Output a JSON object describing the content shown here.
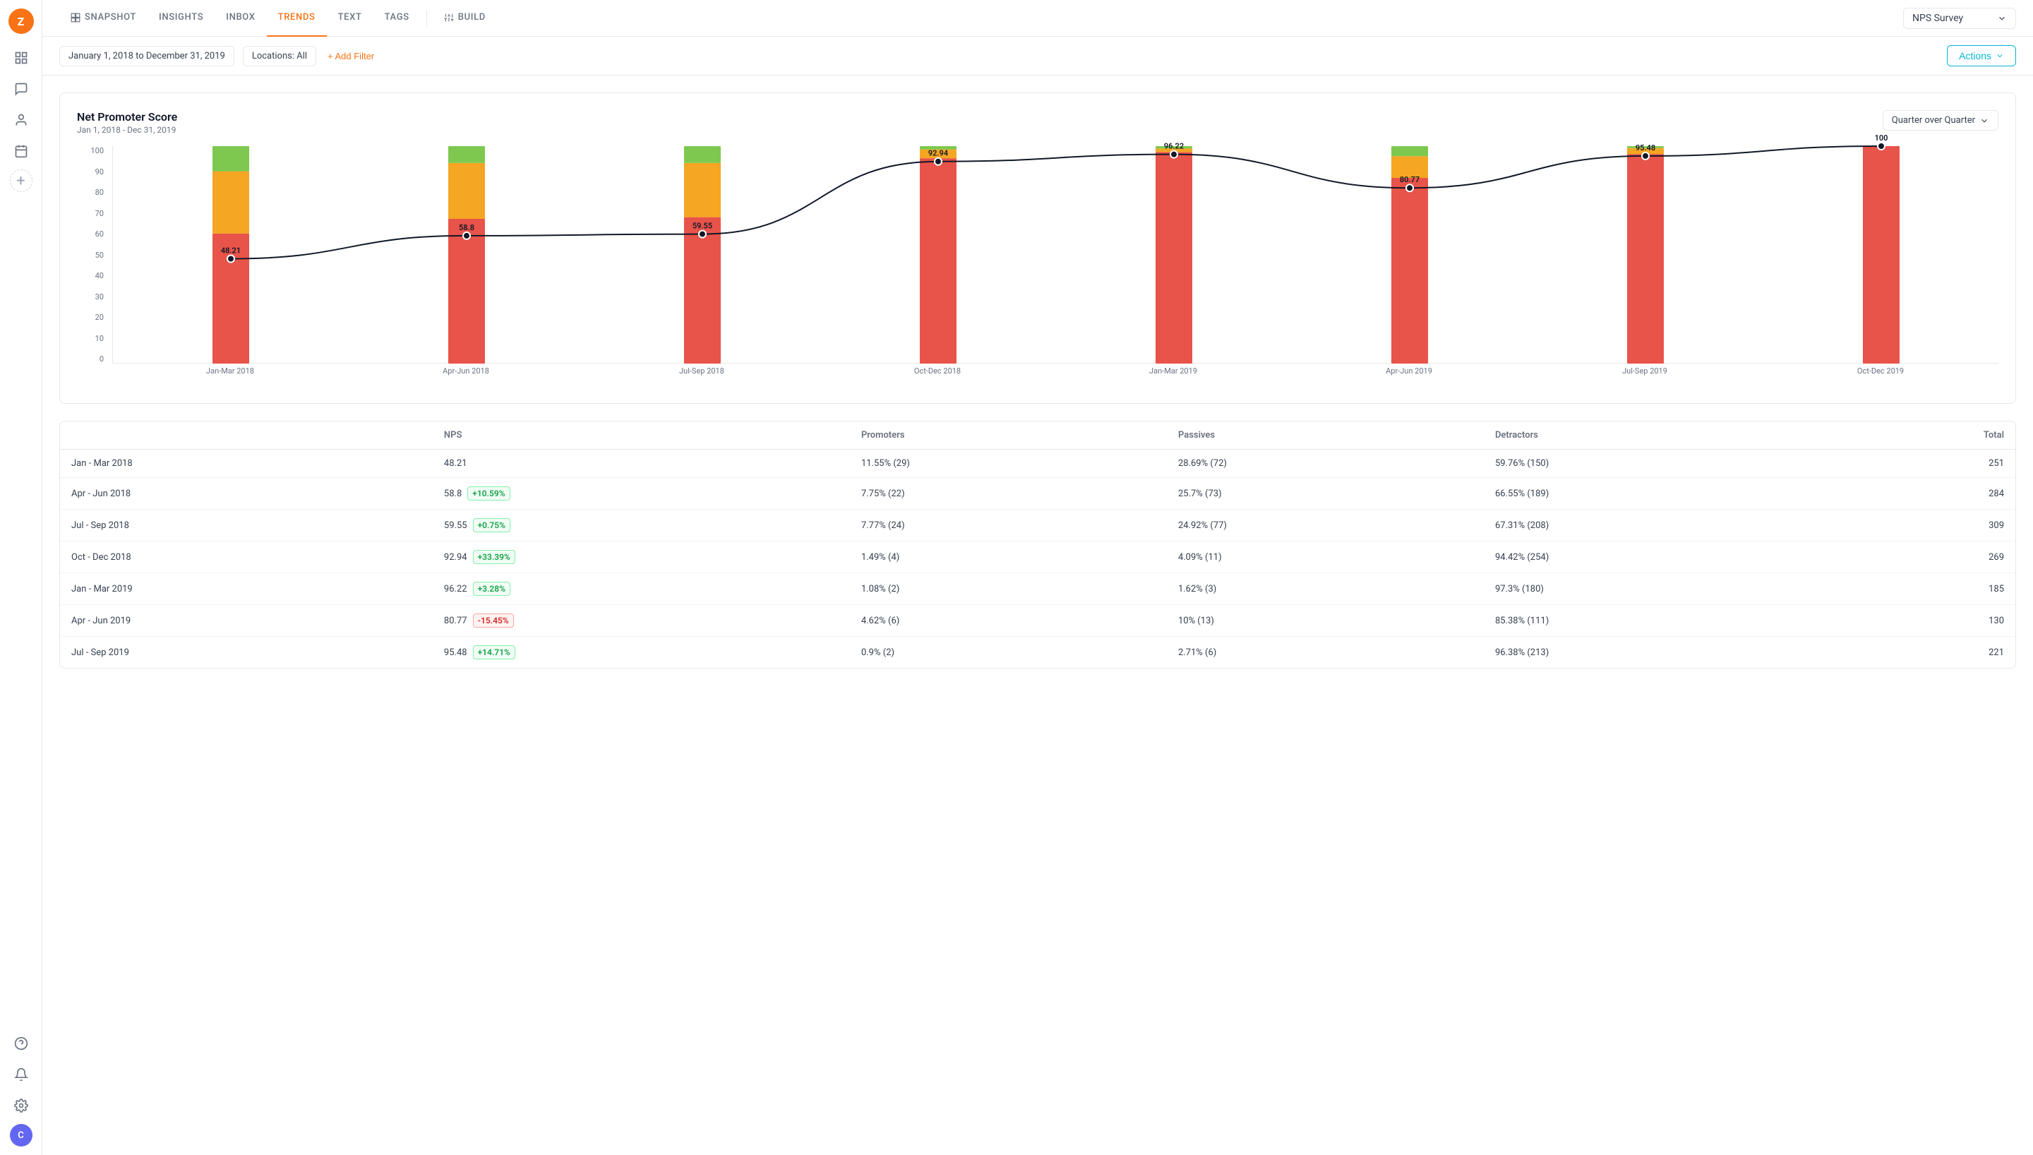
{
  "sidebar": {
    "logo": "Z",
    "avatar": "C",
    "icons": [
      {
        "name": "grid-icon",
        "symbol": "⊞",
        "active": false
      },
      {
        "name": "chat-icon",
        "symbol": "💬",
        "active": false
      },
      {
        "name": "person-icon",
        "symbol": "👤",
        "active": false
      },
      {
        "name": "calendar-icon",
        "symbol": "📋",
        "active": false
      },
      {
        "name": "plus-icon",
        "symbol": "+",
        "active": false
      }
    ],
    "bottom_icons": [
      {
        "name": "help-icon",
        "symbol": "?"
      },
      {
        "name": "bell-icon",
        "symbol": "🔔"
      },
      {
        "name": "settings-icon",
        "symbol": "⚙"
      }
    ]
  },
  "topnav": {
    "items": [
      {
        "label": "SNAPSHOT",
        "active": false
      },
      {
        "label": "INSIGHTS",
        "active": false
      },
      {
        "label": "INBOX",
        "active": false
      },
      {
        "label": "TRENDS",
        "active": true
      },
      {
        "label": "TEXT",
        "active": false
      },
      {
        "label": "TAGS",
        "active": false
      },
      {
        "label": "BUILD",
        "active": false,
        "icon": true
      }
    ],
    "survey": "NPS Survey"
  },
  "filters": {
    "date_range": "January 1, 2018 to December 31, 2019",
    "location": "Locations: All",
    "add_filter": "+ Add Filter",
    "actions": "Actions"
  },
  "chart": {
    "title": "Net Promoter Score",
    "subtitle": "Jan 1, 2018 - Dec 31, 2019",
    "period_selector": "Quarter over Quarter",
    "y_labels": [
      "100",
      "90",
      "80",
      "70",
      "60",
      "50",
      "40",
      "30",
      "20",
      "10",
      "0"
    ],
    "bars": [
      {
        "label": "Jan-Mar 2018",
        "nps": 48.21,
        "promoters": 11.55,
        "passives": 28.69,
        "detractors": 59.76
      },
      {
        "label": "Apr-Jun 2018",
        "nps": 58.8,
        "promoters": 7.75,
        "passives": 25.7,
        "detractors": 66.55
      },
      {
        "label": "Jul-Sep 2018",
        "nps": 59.55,
        "promoters": 7.77,
        "passives": 24.92,
        "detractors": 67.31
      },
      {
        "label": "Oct-Dec 2018",
        "nps": 92.94,
        "promoters": 1.49,
        "passives": 4.09,
        "detractors": 94.42
      },
      {
        "label": "Jan-Mar 2019",
        "nps": 96.22,
        "promoters": 1.08,
        "passives": 1.62,
        "detractors": 97.3
      },
      {
        "label": "Apr-Jun 2019",
        "nps": 80.77,
        "promoters": 4.62,
        "passives": 10,
        "detractors": 85.38
      },
      {
        "label": "Jul-Sep 2019",
        "nps": 95.48,
        "promoters": 0.9,
        "passives": 2.71,
        "detractors": 96.38
      },
      {
        "label": "Oct-Dec 2019",
        "nps": 100,
        "promoters": 0,
        "passives": 0,
        "detractors": 100
      }
    ]
  },
  "table": {
    "headers": [
      "",
      "NPS",
      "Promoters",
      "Passives",
      "Detractors",
      "Total"
    ],
    "rows": [
      {
        "period": "Jan - Mar 2018",
        "nps": "48.21",
        "delta": null,
        "delta_type": null,
        "promoters": "11.55% (29)",
        "passives": "28.69% (72)",
        "detractors": "59.76% (150)",
        "total": "251"
      },
      {
        "period": "Apr - Jun 2018",
        "nps": "58.8",
        "delta": "+10.59%",
        "delta_type": "pos",
        "promoters": "7.75% (22)",
        "passives": "25.7% (73)",
        "detractors": "66.55% (189)",
        "total": "284"
      },
      {
        "period": "Jul - Sep 2018",
        "nps": "59.55",
        "delta": "+0.75%",
        "delta_type": "pos",
        "promoters": "7.77% (24)",
        "passives": "24.92% (77)",
        "detractors": "67.31% (208)",
        "total": "309"
      },
      {
        "period": "Oct - Dec 2018",
        "nps": "92.94",
        "delta": "+33.39%",
        "delta_type": "pos",
        "promoters": "1.49% (4)",
        "passives": "4.09% (11)",
        "detractors": "94.42% (254)",
        "total": "269"
      },
      {
        "period": "Jan - Mar 2019",
        "nps": "96.22",
        "delta": "+3.28%",
        "delta_type": "pos",
        "promoters": "1.08% (2)",
        "passives": "1.62% (3)",
        "detractors": "97.3% (180)",
        "total": "185"
      },
      {
        "period": "Apr - Jun 2019",
        "nps": "80.77",
        "delta": "-15.45%",
        "delta_type": "neg",
        "promoters": "4.62% (6)",
        "passives": "10% (13)",
        "detractors": "85.38% (111)",
        "total": "130"
      },
      {
        "period": "Jul - Sep 2019",
        "nps": "95.48",
        "delta": "+14.71%",
        "delta_type": "pos",
        "promoters": "0.9% (2)",
        "passives": "2.71% (6)",
        "detractors": "96.38% (213)",
        "total": "221"
      }
    ]
  },
  "colors": {
    "promoters": "#7ec850",
    "passives": "#f5a623",
    "detractors": "#e8534a",
    "accent": "#f97316",
    "teal": "#06b6d4"
  }
}
